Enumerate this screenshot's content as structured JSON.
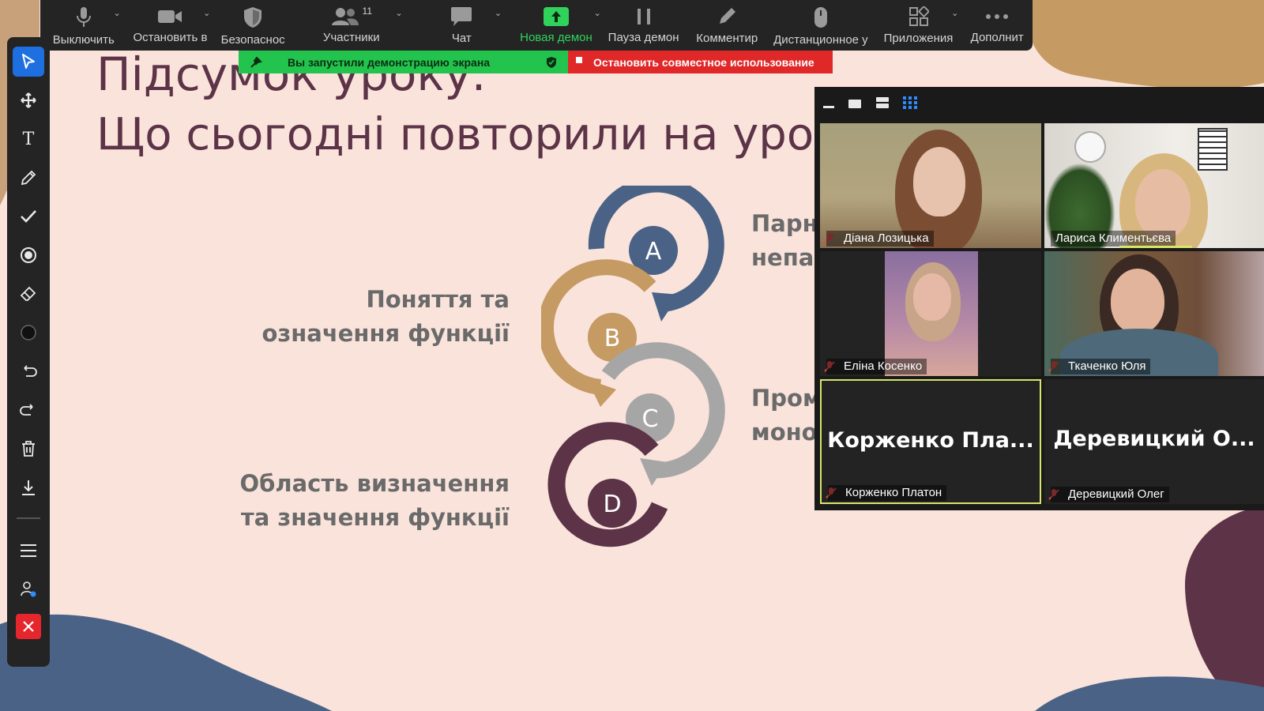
{
  "slide": {
    "title_line1": "Підсумок уроку.",
    "title_line2": "Що сьогодні повторили на уроці",
    "labels_left": [
      "Поняття та",
      "означення функції",
      "Область визначення",
      "та значення функції"
    ],
    "labels_right": [
      "Парн",
      "непар",
      "Пром",
      "моно"
    ],
    "cycle_letters": [
      "A",
      "B",
      "C",
      "D"
    ],
    "colors": {
      "a": "#4a6285",
      "b": "#c59a63",
      "c": "#a6a6a6",
      "d": "#5c3347",
      "bg": "#f9e3db"
    }
  },
  "toolbar": {
    "items": [
      {
        "label": "Выключить",
        "icon": "microphone-icon"
      },
      {
        "label": "Остановить в",
        "icon": "video-camera-icon"
      },
      {
        "label": "Безопаснос",
        "icon": "security-shield-icon"
      },
      {
        "label": "Участники",
        "icon": "participants-icon",
        "count": "11"
      },
      {
        "label": "Чат",
        "icon": "chat-icon"
      },
      {
        "label": "Новая демон",
        "icon": "share-screen-icon"
      },
      {
        "label": "Пауза демон",
        "icon": "pause-icon"
      },
      {
        "label": "Комментир",
        "icon": "annotate-pencil-icon"
      },
      {
        "label": "Дистанционное у",
        "icon": "remote-control-icon"
      },
      {
        "label": "Приложения",
        "icon": "apps-icon"
      },
      {
        "label": "Дополнит",
        "icon": "more-icon"
      }
    ]
  },
  "share_banner": {
    "status": "Вы запустили демонстрацию экрана",
    "stop": "Остановить совместное использование"
  },
  "gallery": {
    "participants": [
      {
        "name": "Діана Лозицька",
        "muted": true
      },
      {
        "name": "Лариса Климентьєва",
        "muted": false
      },
      {
        "name": "Еліна Косенко",
        "muted": true
      },
      {
        "name": "Ткаченко Юля",
        "muted": true
      },
      {
        "name": "Корженко Платон",
        "display": "Корженко  Пла...",
        "muted": true
      },
      {
        "name": "Деревицкий Олег",
        "display": "Деревицкий  О...",
        "muted": true
      }
    ]
  }
}
